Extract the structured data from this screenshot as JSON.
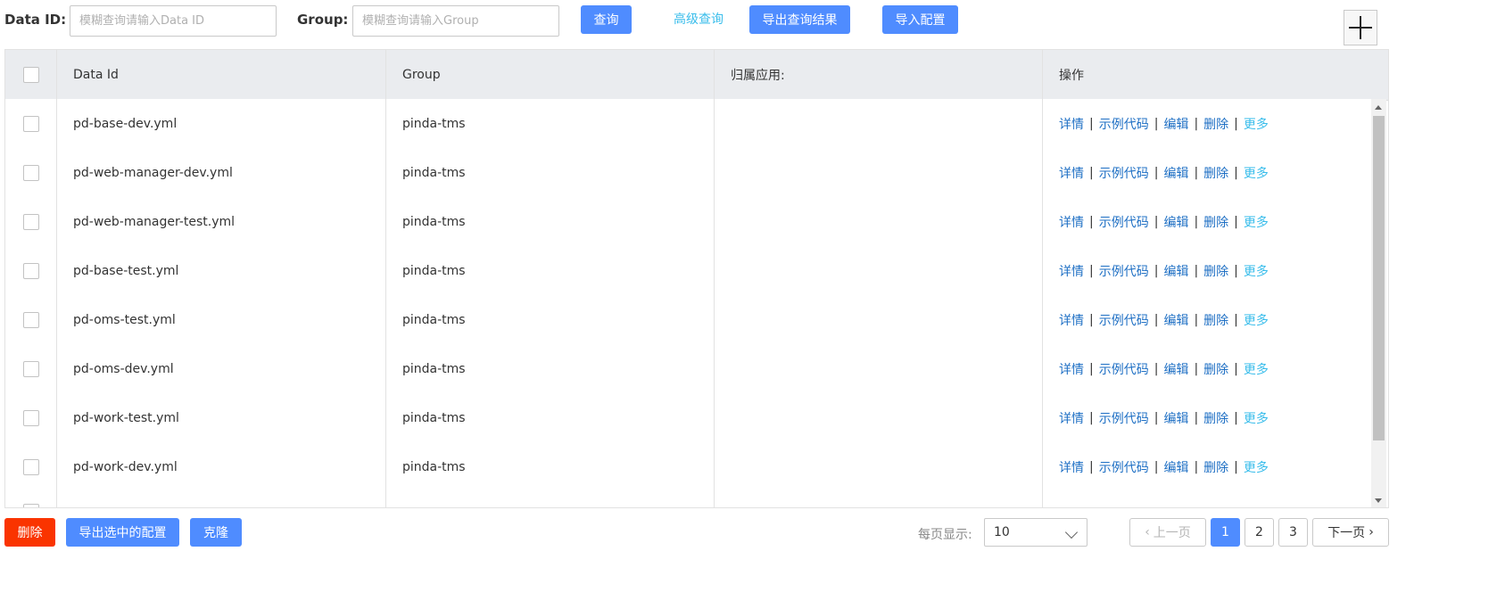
{
  "search": {
    "data_id_label": "Data ID:",
    "data_id_placeholder": "模糊查询请输入Data ID",
    "data_id_value": "",
    "group_label": "Group:",
    "group_placeholder": "模糊查询请输入Group",
    "group_value": "",
    "query_button": "查询",
    "advanced_query": "高级查询",
    "export_results_button": "导出查询结果",
    "import_config_button": "导入配置"
  },
  "table": {
    "columns": [
      "Data Id",
      "Group",
      "归属应用:",
      "操作"
    ],
    "actions": {
      "detail": "详情",
      "sample_code": "示例代码",
      "edit": "编辑",
      "delete": "删除",
      "more": "更多",
      "separator": "|"
    },
    "rows": [
      {
        "data_id": "pd-base-dev.yml",
        "group": "pinda-tms",
        "app": ""
      },
      {
        "data_id": "pd-web-manager-dev.yml",
        "group": "pinda-tms",
        "app": ""
      },
      {
        "data_id": "pd-web-manager-test.yml",
        "group": "pinda-tms",
        "app": ""
      },
      {
        "data_id": "pd-base-test.yml",
        "group": "pinda-tms",
        "app": ""
      },
      {
        "data_id": "pd-oms-test.yml",
        "group": "pinda-tms",
        "app": ""
      },
      {
        "data_id": "pd-oms-dev.yml",
        "group": "pinda-tms",
        "app": ""
      },
      {
        "data_id": "pd-work-test.yml",
        "group": "pinda-tms",
        "app": ""
      },
      {
        "data_id": "pd-work-dev.yml",
        "group": "pinda-tms",
        "app": ""
      }
    ]
  },
  "footer": {
    "delete_button": "删除",
    "export_selected_button": "导出选中的配置",
    "clone_button": "克隆",
    "page_size_label": "每页显示:",
    "page_size_value": "10",
    "prev_page": "上一页",
    "next_page": "下一页",
    "pages": [
      "1",
      "2",
      "3"
    ],
    "current_page": "1"
  },
  "colors": {
    "primary": "#4f8cff",
    "danger": "#fa3400",
    "link": "#1e6fc4",
    "link_light": "#39bdeb",
    "header_bg": "#eaecef"
  },
  "icons": {
    "add": "plus-icon",
    "prev": "chevron-left-icon",
    "next": "chevron-right-icon",
    "dropdown": "chevron-down-icon"
  }
}
